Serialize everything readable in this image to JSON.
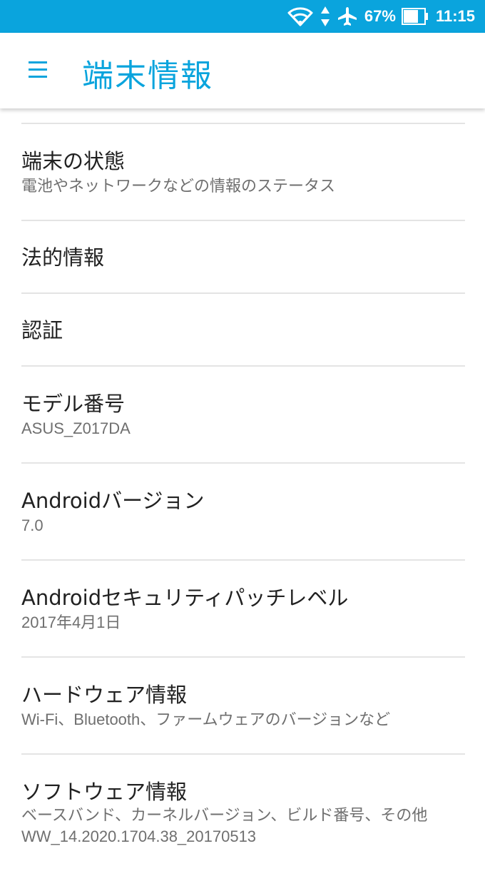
{
  "status_bar": {
    "battery_percent": "67%",
    "time": "11:15",
    "icons": [
      "wifi-icon",
      "data-arrows-icon",
      "airplane-icon",
      "battery-icon"
    ]
  },
  "app_bar": {
    "title": "端末情報",
    "menu_icon": "hamburger-menu-icon"
  },
  "items": [
    {
      "title": "端末の状態",
      "summary": "電池やネットワークなどの情報のステータス"
    },
    {
      "title": "法的情報"
    },
    {
      "title": "認証"
    },
    {
      "title": "モデル番号",
      "summary": "ASUS_Z017DA"
    },
    {
      "title": "Androidバージョン",
      "summary": "7.0"
    },
    {
      "title": "Androidセキュリティパッチレベル",
      "summary": "2017年4月1日"
    },
    {
      "title": "ハードウェア情報",
      "summary": "Wi-Fi、Bluetooth、ファームウェアのバージョンなど"
    },
    {
      "title": "ソフトウェア情報",
      "summary": "ベースバンド、カーネルバージョン、ビルド番号、その他",
      "summary2": "WW_14.2020.1704.38_20170513"
    }
  ],
  "colors": {
    "accent": "#0aa4dd",
    "title_text": "#212121",
    "summary_text": "#6f6f6f",
    "divider": "#e4e4e4"
  }
}
